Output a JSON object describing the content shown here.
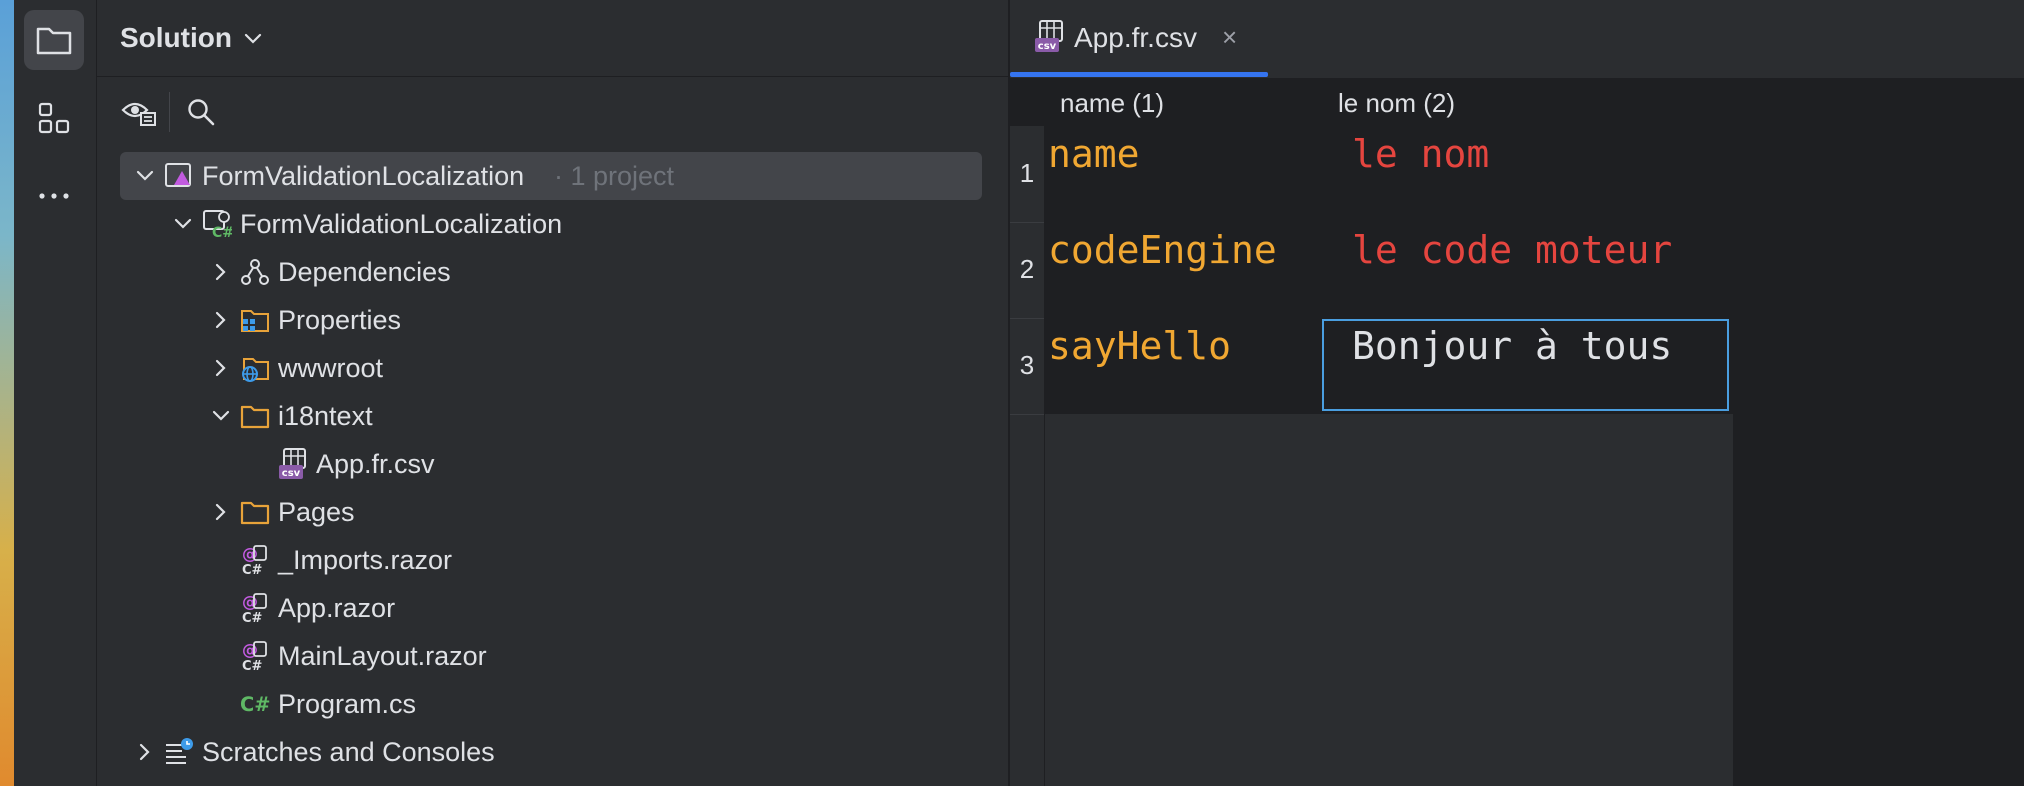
{
  "panel": {
    "title": "Solution"
  },
  "tree": [
    {
      "label": "FormValidationLocalization",
      "suffix": "· 1 project",
      "icon": "solution-icon",
      "indent": 0,
      "expanded": true,
      "selected": true
    },
    {
      "label": "FormValidationLocalization",
      "icon": "csharp-project-icon",
      "indent": 1,
      "expanded": true
    },
    {
      "label": "Dependencies",
      "icon": "dependencies-icon",
      "indent": 2,
      "expanded": false
    },
    {
      "label": "Properties",
      "icon": "properties-folder-icon",
      "indent": 2,
      "expanded": false
    },
    {
      "label": "wwwroot",
      "icon": "web-folder-icon",
      "indent": 2,
      "expanded": false
    },
    {
      "label": "i18ntext",
      "icon": "folder-icon",
      "indent": 2,
      "expanded": true
    },
    {
      "label": "App.fr.csv",
      "icon": "csv-file-icon",
      "indent": 3,
      "leaf": true
    },
    {
      "label": "Pages",
      "icon": "folder-icon",
      "indent": 2,
      "expanded": false
    },
    {
      "label": "_Imports.razor",
      "icon": "razor-file-icon",
      "indent": 2,
      "leaf": true
    },
    {
      "label": "App.razor",
      "icon": "razor-file-icon",
      "indent": 2,
      "leaf": true
    },
    {
      "label": "MainLayout.razor",
      "icon": "razor-file-icon",
      "indent": 2,
      "leaf": true
    },
    {
      "label": "Program.cs",
      "icon": "csharp-file-icon",
      "indent": 2,
      "leaf": true
    },
    {
      "label": "Scratches and Consoles",
      "icon": "scratches-icon",
      "indent": 0,
      "expanded": false
    }
  ],
  "editor": {
    "tab_label": "App.fr.csv",
    "tab_close": "×",
    "columns": [
      "name (1)",
      "le nom (2)"
    ],
    "rows": [
      {
        "num": "1",
        "key": "name",
        "value": "le nom"
      },
      {
        "num": "2",
        "key": "codeEngine",
        "value": "le code moteur"
      },
      {
        "num": "3",
        "key": "sayHello",
        "value": "Bonjour à tous"
      }
    ]
  },
  "colors": {
    "accent": "#3574f0",
    "key_text": "#f0a732",
    "value_text": "#e5453f",
    "selection_border": "#4a9ee0"
  }
}
